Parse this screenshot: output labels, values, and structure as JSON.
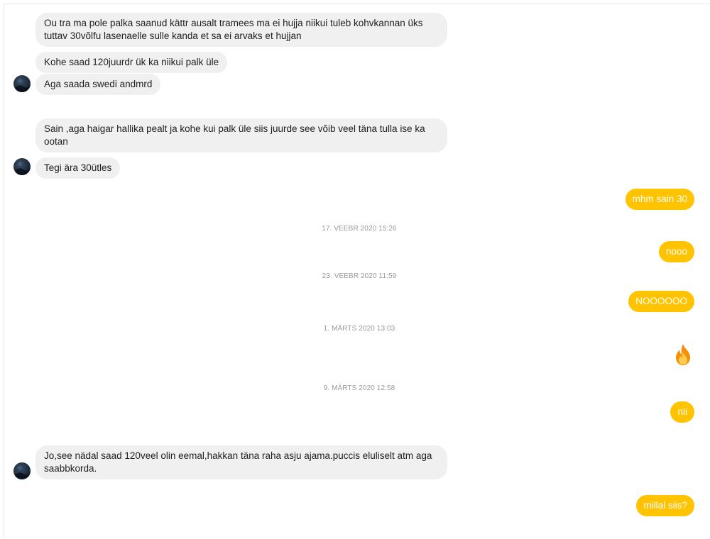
{
  "colors": {
    "incoming_bg": "#f0f0f0",
    "outgoing_bg": "#ffc300",
    "timestamp": "#9a9a9a"
  },
  "messages": [
    {
      "dir": "in",
      "text": "Ou tra ma pole palka saanud kättr ausalt tramees ma ei hujja niikui tuleb kohvkannan üks tuttav 30võlfu lasenaelle sulle kanda et sa ei arvaks et hujjan"
    },
    {
      "dir": "in",
      "text": "Kohe saad 120juurdr ük ka niikui palk üle"
    },
    {
      "dir": "in",
      "text": "Aga saada swedi andmrd"
    },
    {
      "dir": "in",
      "text": "Sain ,aga haigar hallika pealt ja kohe kui palk üle siis juurde see võib veel täna tulla ise ka ootan"
    },
    {
      "dir": "in",
      "text": "Tegi ära 30ütles"
    },
    {
      "dir": "out",
      "text": "mhm sain 30"
    },
    {
      "dir": "time",
      "text": "17. VEEBR 2020 15:26"
    },
    {
      "dir": "out",
      "text": "nooo"
    },
    {
      "dir": "time",
      "text": "23. VEEBR 2020 11:59"
    },
    {
      "dir": "out",
      "text": "NOOOOOO"
    },
    {
      "dir": "time",
      "text": "1. MÄRTS 2020 13:03"
    },
    {
      "dir": "out",
      "icon": "fire-emoji-icon"
    },
    {
      "dir": "time",
      "text": "9. MÄRTS 2020 12:58"
    },
    {
      "dir": "out",
      "text": "nii"
    },
    {
      "dir": "in",
      "text": "Jo,see nädal saad 120veel olin eemal,hakkan täna raha asju ajama.puccis eluliselt atm aga saabbkorda."
    },
    {
      "dir": "out",
      "text": "millal siis?"
    }
  ]
}
